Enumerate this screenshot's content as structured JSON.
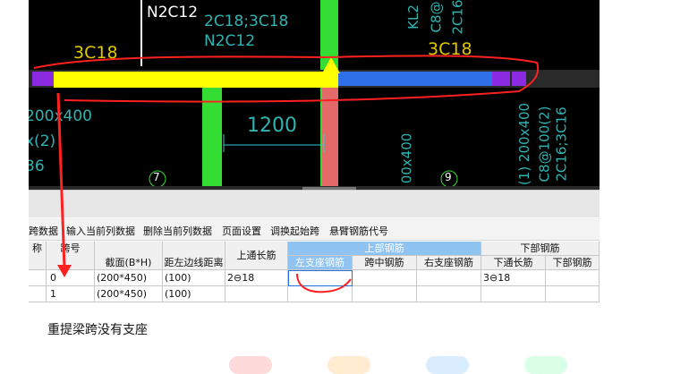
{
  "cad": {
    "labels": {
      "top_center": "N2C12",
      "top_over1": "2C18;3C18",
      "top_over2": "N2C12",
      "left_beam": "3C18",
      "right_beam": "3C18",
      "dimension": "1200",
      "left_section1": "200x400",
      "left_section2": "x(2)",
      "left_section3": "36",
      "right_vert1": "(1) 200x400",
      "right_vert2": "C8@100(2)",
      "right_vert3": "2C16;3C16",
      "mid_vert1": "00x400",
      "top_right_vert1": "KL2",
      "top_right_vert2": "C8@",
      "top_right_vert3": "2C16"
    },
    "axis_left": "7",
    "axis_right": "9"
  },
  "toolbar": {
    "items": [
      "跨数据",
      "输入当前列数据",
      "删除当前列数据",
      "页面设置",
      "调换起始跨",
      "悬臂钢筋代号"
    ]
  },
  "table": {
    "headers_top": {
      "col_name": "称",
      "span_no": "跨号",
      "section": "截面(B*H)",
      "offset": "距左边线距离",
      "top_through": "上通长筋",
      "top_group": "上部钢筋",
      "bottom_group": "下部钢筋"
    },
    "headers_sub": {
      "left_support": "左支座钢筋",
      "mid_span": "跨中钢筋",
      "right_support": "右支座钢筋",
      "bottom_through": "下通长筋",
      "bottom_rebar": "下部钢筋"
    },
    "rows": [
      {
        "span": "0",
        "section": "(200*450)",
        "offset": "(100)",
        "top_through": "2⊖18",
        "bottom_through": "3⊖18"
      },
      {
        "span": "1",
        "section": "(200*450)",
        "offset": "(100)",
        "top_through": "",
        "bottom_through": ""
      }
    ]
  },
  "caption": "重提梁跨没有支座"
}
